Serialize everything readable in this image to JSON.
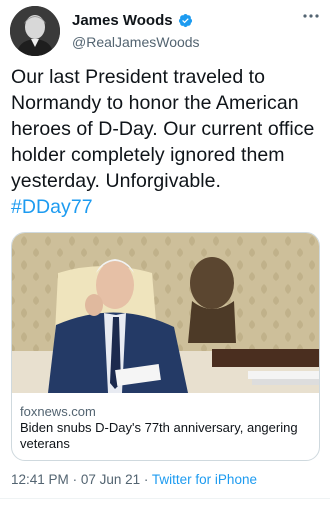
{
  "author": {
    "display_name": "James Woods",
    "handle": "@RealJamesWoods",
    "avatar_icon": "user-avatar",
    "verified_icon": "verified-badge-icon",
    "more_icon": "more-options-icon"
  },
  "tweet": {
    "text": "Our last President traveled to Normandy to honor the American heroes of D-Day. Our current office holder completely ignored them yesterday. Unforgivable.",
    "hashtag": "#DDay77"
  },
  "link_card": {
    "domain": "foxnews.com",
    "title": "Biden snubs D-Day's 77th anniversary, angering veterans"
  },
  "meta": {
    "time": "12:41 PM",
    "separator": "·",
    "date": "07 Jun 21",
    "client": "Twitter for iPhone"
  },
  "colors": {
    "accent": "#1d9bf0",
    "secondary_text": "#536471",
    "border": "#cfd9de"
  }
}
